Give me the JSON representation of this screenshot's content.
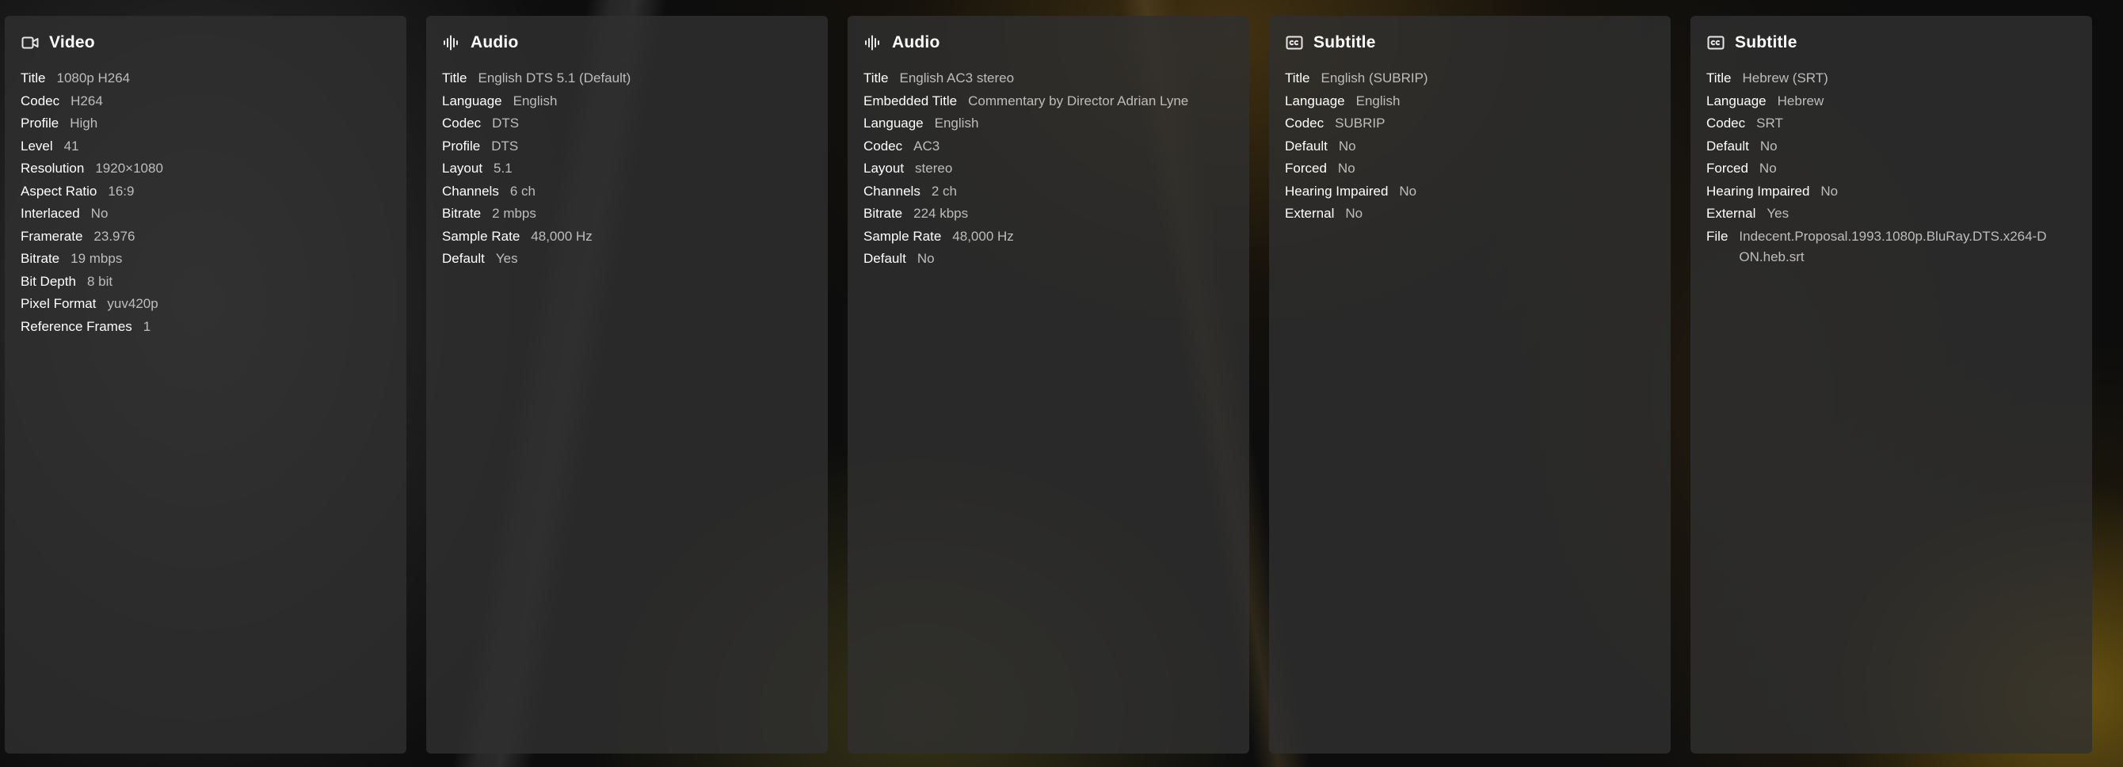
{
  "panels": [
    {
      "title": "Video",
      "icon": "video-camera-icon",
      "rows": [
        {
          "k": "Title",
          "v": "1080p H264"
        },
        {
          "k": "Codec",
          "v": "H264"
        },
        {
          "k": "Profile",
          "v": "High"
        },
        {
          "k": "Level",
          "v": "41"
        },
        {
          "k": "Resolution",
          "v": "1920×1080"
        },
        {
          "k": "Aspect Ratio",
          "v": "16:9"
        },
        {
          "k": "Interlaced",
          "v": "No"
        },
        {
          "k": "Framerate",
          "v": "23.976"
        },
        {
          "k": "Bitrate",
          "v": "19 mbps"
        },
        {
          "k": "Bit Depth",
          "v": "8 bit"
        },
        {
          "k": "Pixel Format",
          "v": "yuv420p"
        },
        {
          "k": "Reference Frames",
          "v": "1"
        }
      ]
    },
    {
      "title": "Audio",
      "icon": "audio-waveform-icon",
      "rows": [
        {
          "k": "Title",
          "v": "English DTS 5.1 (Default)"
        },
        {
          "k": "Language",
          "v": "English"
        },
        {
          "k": "Codec",
          "v": "DTS"
        },
        {
          "k": "Profile",
          "v": "DTS"
        },
        {
          "k": "Layout",
          "v": "5.1"
        },
        {
          "k": "Channels",
          "v": "6 ch"
        },
        {
          "k": "Bitrate",
          "v": "2 mbps"
        },
        {
          "k": "Sample Rate",
          "v": "48,000 Hz"
        },
        {
          "k": "Default",
          "v": "Yes"
        }
      ]
    },
    {
      "title": "Audio",
      "icon": "audio-waveform-icon",
      "rows": [
        {
          "k": "Title",
          "v": "English AC3 stereo"
        },
        {
          "k": "Embedded Title",
          "v": "Commentary by Director Adrian Lyne"
        },
        {
          "k": "Language",
          "v": "English"
        },
        {
          "k": "Codec",
          "v": "AC3"
        },
        {
          "k": "Layout",
          "v": "stereo"
        },
        {
          "k": "Channels",
          "v": "2 ch"
        },
        {
          "k": "Bitrate",
          "v": "224 kbps"
        },
        {
          "k": "Sample Rate",
          "v": "48,000 Hz"
        },
        {
          "k": "Default",
          "v": "No"
        }
      ]
    },
    {
      "title": "Subtitle",
      "icon": "closed-captions-icon",
      "rows": [
        {
          "k": "Title",
          "v": "English (SUBRIP)"
        },
        {
          "k": "Language",
          "v": "English"
        },
        {
          "k": "Codec",
          "v": "SUBRIP"
        },
        {
          "k": "Default",
          "v": "No"
        },
        {
          "k": "Forced",
          "v": "No"
        },
        {
          "k": "Hearing Impaired",
          "v": "No"
        },
        {
          "k": "External",
          "v": "No"
        }
      ]
    },
    {
      "title": "Subtitle",
      "icon": "closed-captions-icon",
      "rows": [
        {
          "k": "Title",
          "v": "Hebrew (SRT)"
        },
        {
          "k": "Language",
          "v": "Hebrew"
        },
        {
          "k": "Codec",
          "v": "SRT"
        },
        {
          "k": "Default",
          "v": "No"
        },
        {
          "k": "Forced",
          "v": "No"
        },
        {
          "k": "Hearing Impaired",
          "v": "No"
        },
        {
          "k": "External",
          "v": "Yes"
        },
        {
          "k": "File",
          "v": "Indecent.Proposal.1993.1080p.BluRay.DTS.x264-DON.heb.srt"
        }
      ]
    }
  ]
}
